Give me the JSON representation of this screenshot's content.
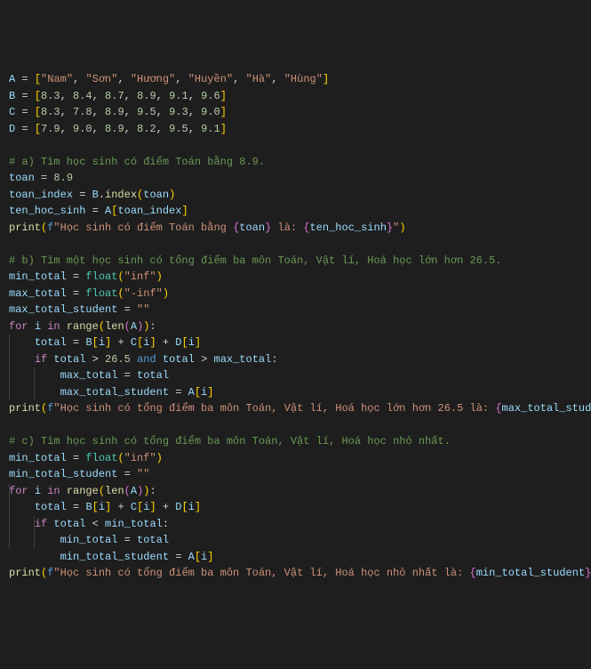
{
  "code": {
    "A_names": [
      "Nam",
      "Sơn",
      "Hương",
      "Huyền",
      "Hà",
      "Hùng"
    ],
    "B_vals": [
      "8.3",
      "8.4",
      "8.7",
      "8.9",
      "9.1",
      "9.6"
    ],
    "C_vals": [
      "8.3",
      "7.8",
      "8.9",
      "9.5",
      "9.3",
      "9.0"
    ],
    "D_vals": [
      "7.9",
      "9.0",
      "8.9",
      "8.2",
      "9.5",
      "9.1"
    ],
    "comment_a": "# a) Tìm học sinh có điểm Toán bằng 8.9.",
    "toan_val": "8.9",
    "print_a_prefix": "Học sinh có điểm Toán bằng ",
    "print_a_mid": " là: ",
    "comment_b": "# b) Tìm một học sinh có tổng điểm ba môn Toán, Vật lí, Hoá học lớn hơn 26.5.",
    "inf": "inf",
    "ninf": "-inf",
    "threshold": "26.5",
    "print_b_prefix": "Học sinh có tổng điểm ba môn Toán, Vật lí, Hoá học lớn hơn 26.5 là: ",
    "comment_c": "# c) Tìm học sinh có tổng điểm ba môn Toán, Vật lí, Hoá học nhỏ nhất.",
    "print_c_prefix": "Học sinh có tổng điểm ba môn Toán, Vật lí, Hoá học nhỏ nhất là: "
  }
}
